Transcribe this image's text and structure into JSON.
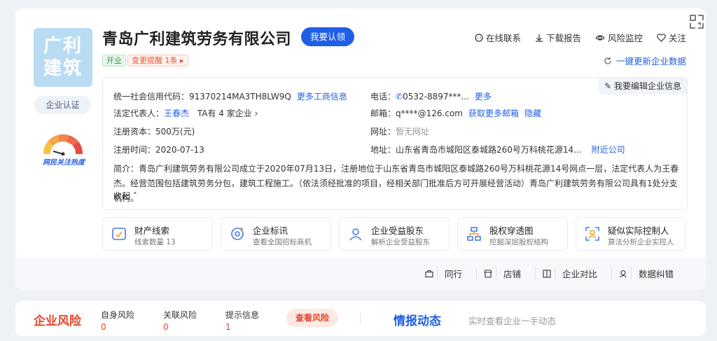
{
  "company": {
    "logo_text_line1": "广利",
    "logo_text_line2": "建筑",
    "name": "青岛广利建筑劳务有限公司",
    "claim_label": "我要认领",
    "status_tag": "开业",
    "change_tag": "变更提醒 1条",
    "certify_label": "企业认证",
    "heat_label": "网民关注热度"
  },
  "top_actions": {
    "contact": "在线联系",
    "download": "下载报告",
    "monitor": "风险监控",
    "follow": "关注",
    "update": "一键更新企业数据"
  },
  "info": {
    "edit_label": "我要编辑企业信息",
    "credit_code_label": "统一社会信用代码：",
    "credit_code": "91370214MA3TH8LW9Q",
    "credit_more": "更多工商信息",
    "legal_label": "法定代表人：",
    "legal_name": "王春杰",
    "legal_companies": "TA有 4 家企业",
    "capital_label": "注册资本：",
    "capital": "500万(元)",
    "reg_time_label": "注册时间：",
    "reg_time": "2020-07-13",
    "phone_label": "电话：",
    "phone": "0532-8897***...",
    "phone_more": "更多",
    "email_label": "邮箱：",
    "email": "q****@126.com",
    "email_more": "获取更多邮箱",
    "email_hide": "隐藏",
    "website_label": "网址：",
    "website": "暂无网址",
    "address_label": "地址：",
    "address": "山东省青岛市城阳区泰城路260号万科桃花源14...",
    "address_nearby": "附近公司",
    "intro": "简介：青岛广利建筑劳务有限公司成立于2020年07月13日，注册地位于山东省青岛市城阳区泰城路260号万科桃花源14号网点一层，法定代表人为王春杰。经营范围包括建筑劳务分包，建筑工程施工。（依法须经批准的项目，经相关部门批准后方可开展经营活动）青岛广利建筑劳务有限公司具有1处分支机构。",
    "fold_label": "收起"
  },
  "features": [
    {
      "title": "财产线索",
      "sub": "线索数量 13"
    },
    {
      "title": "企业标讯",
      "sub": "查看全国招标商机"
    },
    {
      "title": "企业受益股东",
      "sub": "解析企业受益股东"
    },
    {
      "title": "股权穿透图",
      "sub": "挖掘深层股权结构"
    },
    {
      "title": "疑似实际控制人",
      "sub": "算法分析企业实控人"
    }
  ],
  "bottom_actions": {
    "peer": "同行",
    "store": "店铺",
    "compare": "企业对比",
    "correct": "数据纠错"
  },
  "risk": {
    "title": "企业风险",
    "self_label": "自身风险",
    "self_value": "0",
    "related_label": "关联风险",
    "related_value": "0",
    "hint_label": "提示信息",
    "hint_value": "1",
    "button": "查看风险",
    "intel_title": "情报动态",
    "intel_sub": "实时查看企业一手动态"
  },
  "colors": {
    "brand": "#1f5ee6",
    "risk": "#e2472b",
    "logo_bg": "#b9dcf3"
  }
}
